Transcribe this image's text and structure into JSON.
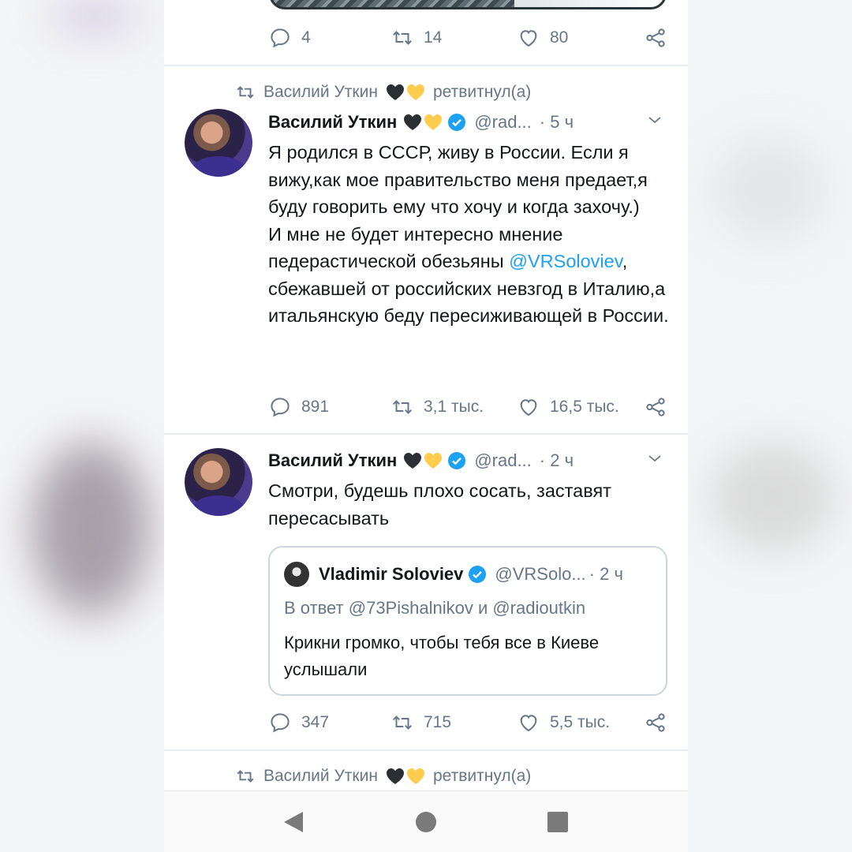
{
  "colors": {
    "accent": "#1da1f2",
    "muted": "#657786",
    "text": "#14171a",
    "verified": "#1da1f2",
    "black_heart": "#292f33",
    "yellow_heart": "#ffcc4d"
  },
  "tweet0": {
    "replies": "4",
    "retweets": "14",
    "likes": "80"
  },
  "retweet_banner": {
    "name": "Василий Уткин",
    "action": "ретвитнул(а)"
  },
  "tweet1": {
    "name": "Василий Уткин",
    "handle": "@rad...",
    "time": "· 5 ч",
    "text_before": "Я родился в СССР, живу в России. Если я вижу,как мое правительство меня предает,я буду говорить ему что хочу и когда захочу.)\nИ мне не будет интересно мнение педерастической обезьяны ",
    "mention": "@VRSoloviev",
    "text_after": ", сбежавшей от российских невзгод в Италию,а итальянскую беду пересиживающей в России.",
    "replies": "891",
    "retweets": "3,1 тыс.",
    "likes": "16,5 тыс."
  },
  "tweet2": {
    "name": "Василий Уткин",
    "handle": "@rad...",
    "time": "· 2 ч",
    "text": "Смотри, будешь плохо сосать, заставят пересасывать",
    "replies": "347",
    "retweets": "715",
    "likes": "5,5 тыс.",
    "quote": {
      "name": "Vladimir Soloviev",
      "handle": "@VRSolo...",
      "time": "· 2 ч",
      "reply_to": "В ответ @73Pishalnikov и @radioutkin",
      "text": "Крикни громко, чтобы тебя все в Киеве услышали"
    }
  },
  "retweet_banner2": {
    "name": "Василий Уткин",
    "action": "ретвитнул(а)"
  },
  "icons": [
    "reply-icon",
    "retweet-icon",
    "like-icon",
    "share-icon",
    "verified-icon",
    "chevron-down-icon",
    "back-icon",
    "home-icon",
    "recents-icon"
  ]
}
